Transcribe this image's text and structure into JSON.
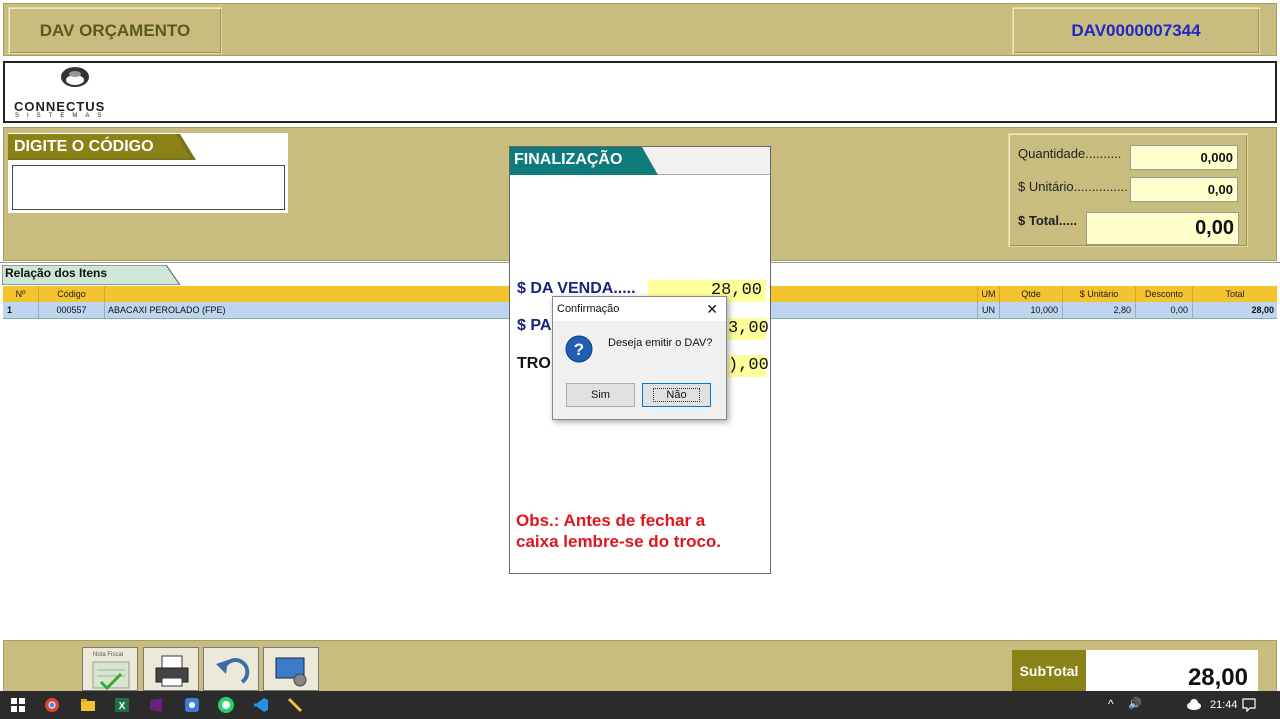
{
  "header": {
    "title": "DAV ORÇAMENTO",
    "dav_number": "DAV0000007344"
  },
  "logo": {
    "name": "CONNECTUS",
    "subtitle": "SISTEMAS"
  },
  "code_entry": {
    "label": "DIGITE O CÓDIGO",
    "value": ""
  },
  "totals_panel": {
    "quantidade_label": "Quantidade..........",
    "quantidade_value": "0,000",
    "unitario_label": "$ Unitário...............",
    "unitario_value": "0,00",
    "total_label": "$ Total.....",
    "total_value": "0,00"
  },
  "items": {
    "tab_label": "Relação dos Itens",
    "columns": [
      "Nº",
      "Código",
      "",
      "UM",
      "Qtde",
      "$ Unitário",
      "Desconto",
      "Total"
    ],
    "rows": [
      {
        "n": "1",
        "codigo": "000557",
        "descricao": "ABACAXI PEROLADO (FPE)",
        "um": "UN",
        "qtde": "10,000",
        "unitario": "2,80",
        "desconto": "0,00",
        "total": "28,00"
      }
    ]
  },
  "footer": {
    "buttons": [
      "nota-fiscal-icon",
      "printer-icon",
      "undo-icon",
      "screen-settings-icon"
    ],
    "nota_fiscal_text": "Nota Fiscal",
    "subtotal_label": "SubTotal",
    "subtotal_value": "28,00"
  },
  "finalizacao": {
    "title": "FINALIZAÇÃO",
    "venda_label": "$ DA VENDA.....",
    "venda_value": "28,00",
    "pago_label": "$ PA",
    "pago_value": "3,00",
    "troco_label": "TRO",
    "troco_value": "),00",
    "obs_line1": "Obs.: Antes de fechar a",
    "obs_line2": "caixa lembre-se do troco."
  },
  "confirm_dialog": {
    "title": "Confirmação",
    "close": "✕",
    "message": "Deseja emitir o DAV?",
    "yes_label": "Sim",
    "no_label": "Não"
  },
  "taskbar": {
    "time": "21:44",
    "tray_up": "^",
    "volume": "🔊"
  },
  "colors": {
    "panel_bg": "#c8bd7e",
    "header_yellow": "#f4c330",
    "row_selected": "#bdd5ee",
    "subtotal_dark": "#8a8217",
    "obs_red": "#e0141c",
    "dav_blue": "#1e28c8"
  }
}
